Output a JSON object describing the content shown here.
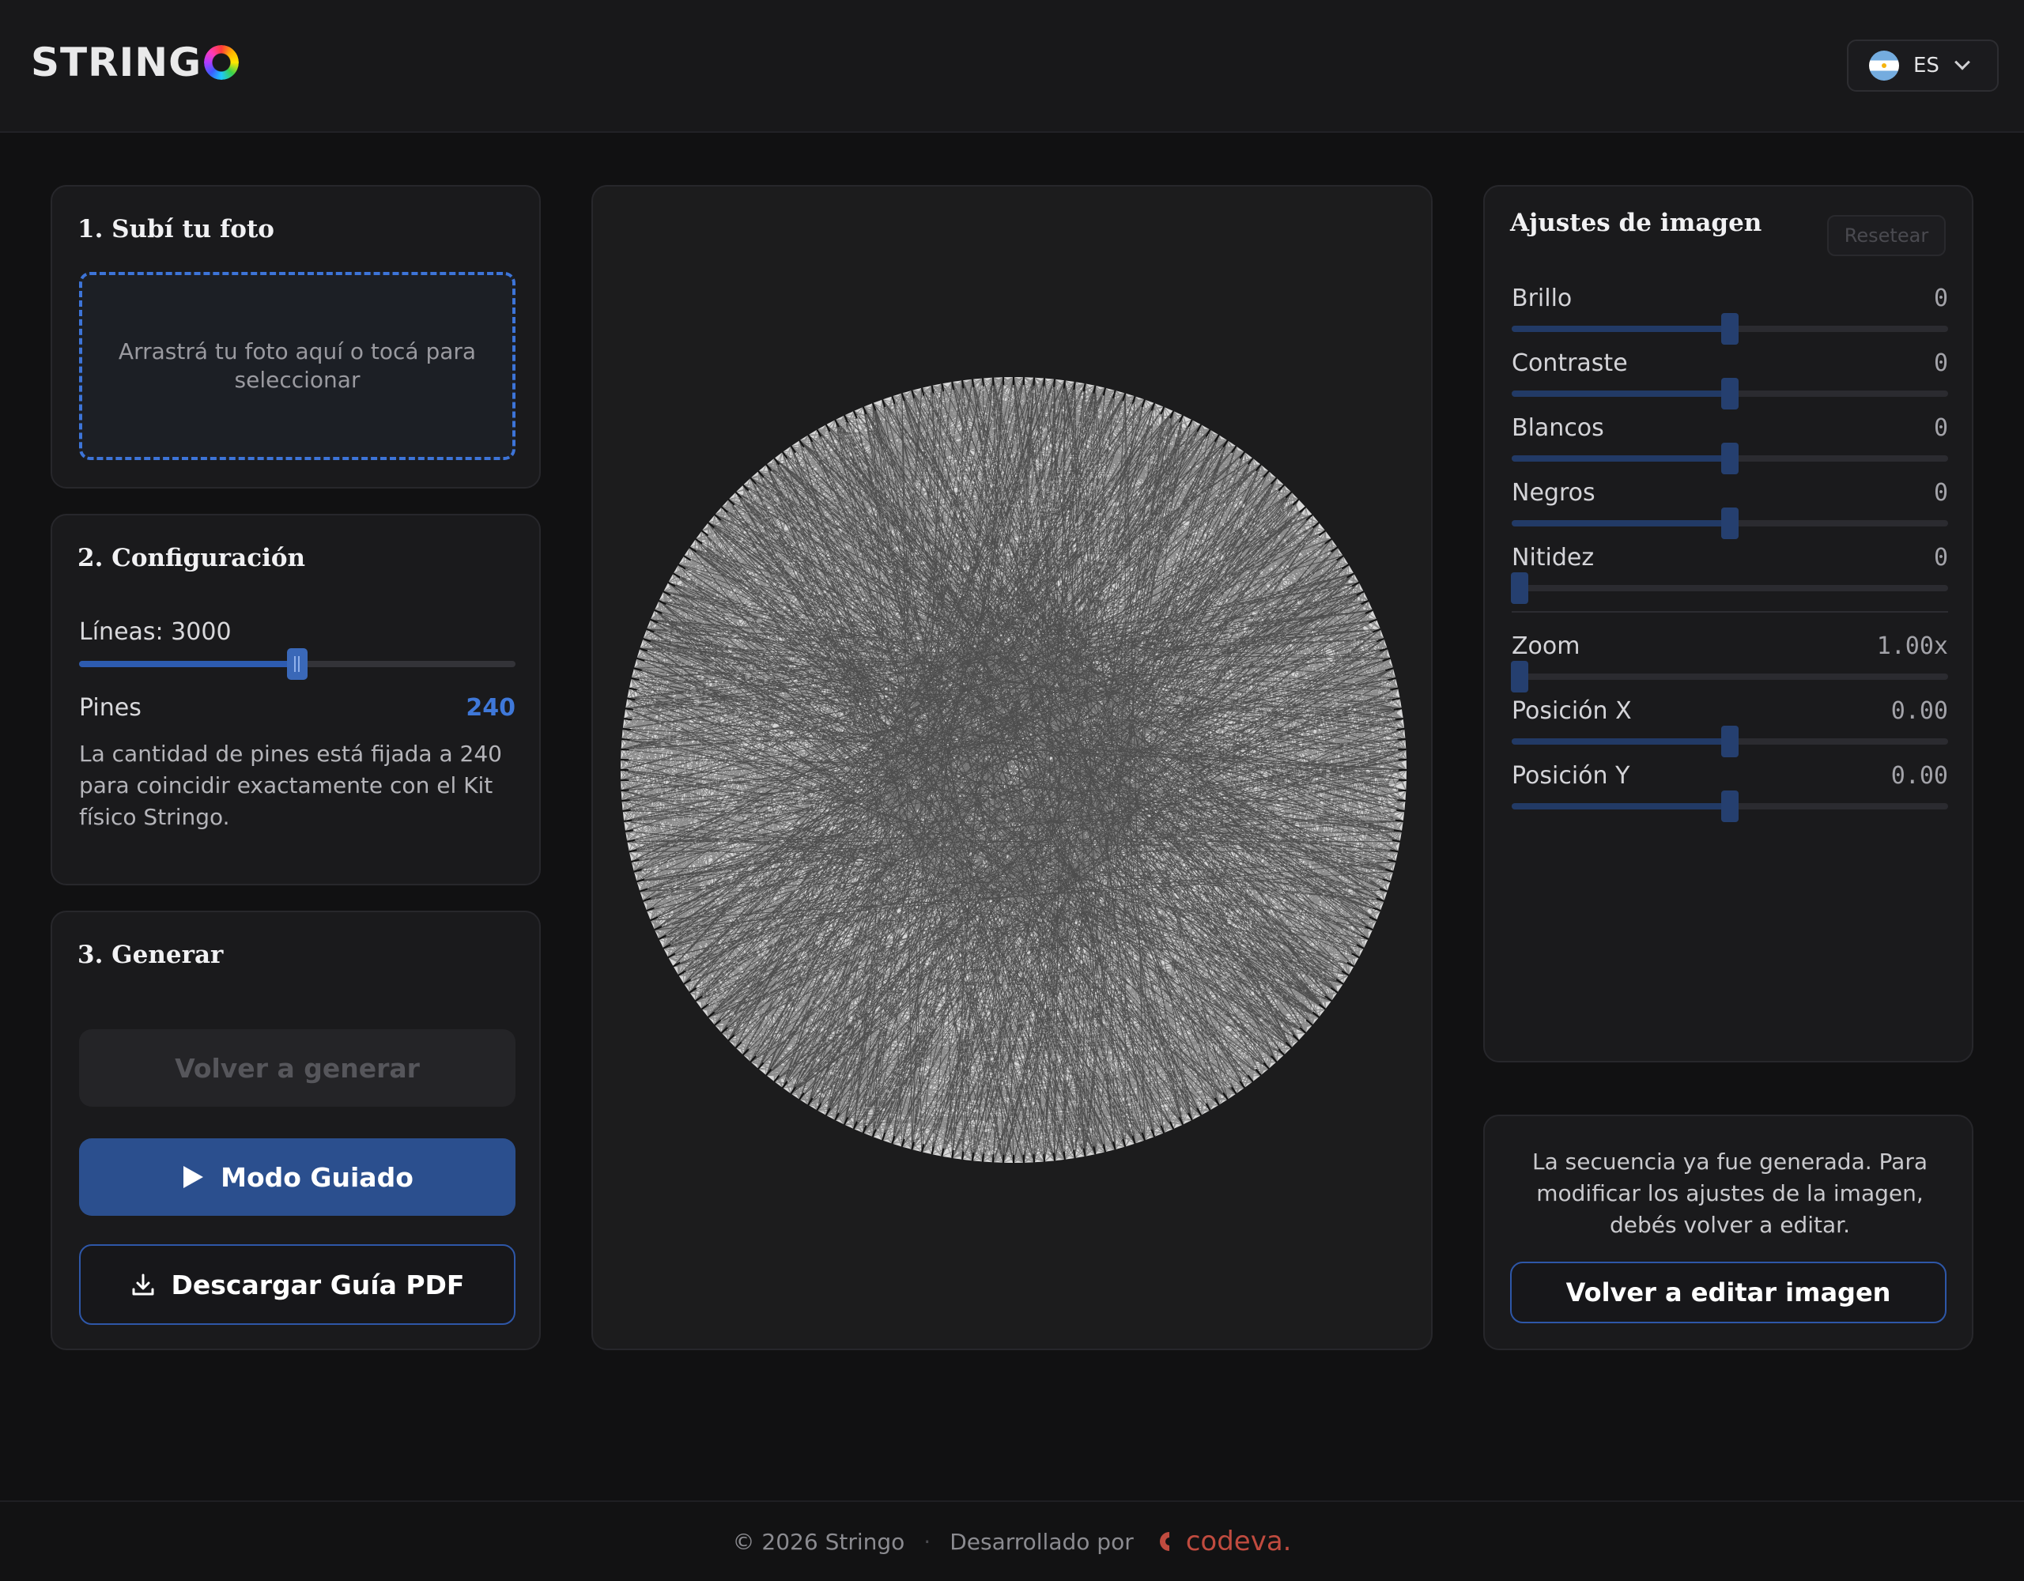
{
  "header": {
    "logo_text": "STRING",
    "language_code": "ES"
  },
  "upload": {
    "title": "1. Subí tu foto",
    "dropzone_text": "Arrastrá tu foto aquí o tocá para seleccionar"
  },
  "config": {
    "title": "2. Configuración",
    "lines_label": "Líneas: 3000",
    "lines_level": 0.5,
    "pins_label": "Pines",
    "pins_value": "240",
    "pins_note": "La cantidad de pines está fijada a 240 para coincidir exactamente con el Kit físico Stringo."
  },
  "generate": {
    "title": "3. Generar",
    "regenerate_label": "Volver a generar",
    "guided_label": "Modo Guiado",
    "pdf_label": "Descargar Guía PDF"
  },
  "adjustments": {
    "title": "Ajustes de imagen",
    "reset_label": "Resetear",
    "sliders": [
      {
        "label": "Brillo",
        "value": "0",
        "level": 0.5
      },
      {
        "label": "Contraste",
        "value": "0",
        "level": 0.5
      },
      {
        "label": "Blancos",
        "value": "0",
        "level": 0.5
      },
      {
        "label": "Negros",
        "value": "0",
        "level": 0.5
      },
      {
        "label": "Nitidez",
        "value": "0",
        "level": 0.0
      },
      {
        "label": "Zoom",
        "value": "1.00x",
        "level": 0.0
      },
      {
        "label": "Posición X",
        "value": "0.00",
        "level": 0.5
      },
      {
        "label": "Posición Y",
        "value": "0.00",
        "level": 0.5
      }
    ]
  },
  "notice": {
    "text": "La secuencia ya fue generada. Para modificar los ajustes de la imagen, debés volver a editar.",
    "edit_button_label": "Volver a editar imagen"
  },
  "footer": {
    "copyright": "© 2026 Stringo",
    "separator": "·",
    "developed_by": "Desarrollado por",
    "brand": "codeva."
  },
  "colors": {
    "accent": "#2b4f8e",
    "dropzone_border": "#3d74d8",
    "brand_codeva": "#c04b3f"
  }
}
